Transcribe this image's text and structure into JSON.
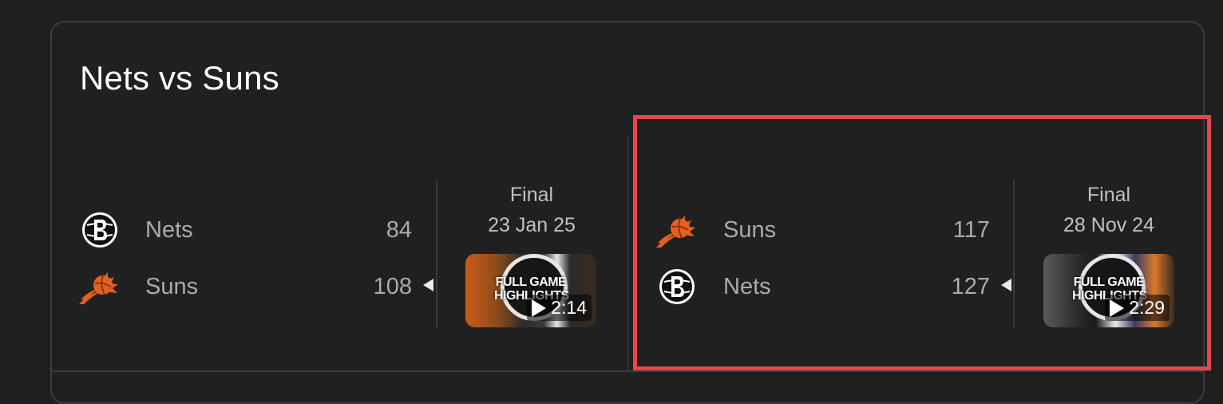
{
  "card": {
    "title": "Nets vs Suns"
  },
  "games": [
    {
      "status": "Final",
      "date": "23 Jan 25",
      "teams": [
        {
          "name": "Nets",
          "score": "84",
          "logo": "nets-logo",
          "winner": false
        },
        {
          "name": "Suns",
          "score": "108",
          "logo": "suns-logo",
          "winner": true
        }
      ],
      "video": {
        "overlay": "FULL GAME HIGHLIGHTS",
        "duration": "2:14"
      }
    },
    {
      "status": "Final",
      "date": "28 Nov 24",
      "teams": [
        {
          "name": "Suns",
          "score": "117",
          "logo": "suns-logo",
          "winner": false
        },
        {
          "name": "Nets",
          "score": "127",
          "logo": "nets-logo",
          "winner": true
        }
      ],
      "video": {
        "overlay": "FULL GAME HIGHLIGHTS",
        "duration": "2:29"
      }
    }
  ],
  "colors": {
    "background": "#1f1f1f",
    "highlight": "#e8454d",
    "suns_orange": "#e56020",
    "text_muted": "#a9abae"
  }
}
